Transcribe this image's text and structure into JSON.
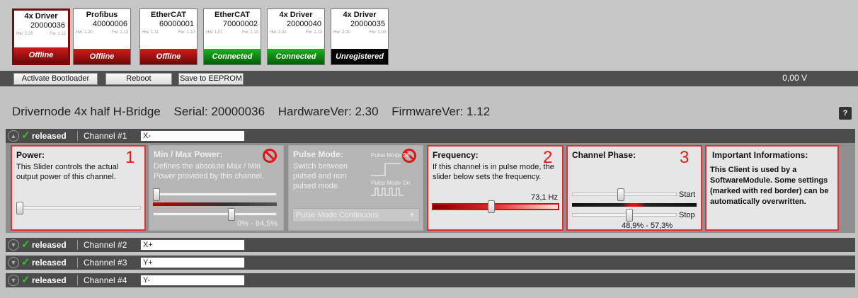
{
  "devices": [
    {
      "name": "4x Driver",
      "serial": "20000036",
      "hw": "Hw: 2.30",
      "fw": "Fw: 1.12",
      "status": "Offline"
    },
    {
      "name": "Profibus",
      "serial": "40000006",
      "hw": "Hw: 1.20",
      "fw": "Fw: 1.13",
      "status": "Offline"
    },
    {
      "name": "EtherCAT",
      "serial": "60000001",
      "hw": "Hw: 1.11",
      "fw": "Fw: 1.10",
      "status": "Offline"
    },
    {
      "name": "EtherCAT",
      "serial": "70000002",
      "hw": "Hw: 1.01",
      "fw": "Fw: 1.10",
      "status": "Connected"
    },
    {
      "name": "4x Driver",
      "serial": "20000040",
      "hw": "Hw: 2.30",
      "fw": "Fw: 1.13",
      "status": "Connected"
    },
    {
      "name": "4x Driver",
      "serial": "20000035",
      "hw": "Hw: 2.30",
      "fw": "Fw: 1.00",
      "status": "Unregistered"
    }
  ],
  "toolbar": {
    "bootloader_label": "Activate Bootloader",
    "reboot_label": "Reboot",
    "eeprom_label": "Save to EEPROM",
    "voltage": "0,00 V"
  },
  "header": {
    "title": "Drivernode 4x half H-Bridge",
    "serial": "Serial: 20000036",
    "hardware": "HardwareVer: 2.30",
    "firmware": "FirmwareVer: 1.12",
    "help_label": "?"
  },
  "channels": [
    {
      "status": "released",
      "name": "Channel #1",
      "value": "X-"
    },
    {
      "status": "released",
      "name": "Channel #2",
      "value": "X+"
    },
    {
      "status": "released",
      "name": "Channel #3",
      "value": "Y+"
    },
    {
      "status": "released",
      "name": "Channel #4",
      "value": "Y-"
    }
  ],
  "panels": {
    "power": {
      "title": "Power:",
      "text": "This Slider controls the actual output power of this channel.",
      "number": "1",
      "level": 0.0
    },
    "minmax": {
      "title": "Min / Max Power:",
      "text": "Defines the absolute Max / Min Power provided by this channel.",
      "range": "0% - 64,5%",
      "min": 0.0,
      "max": 0.645
    },
    "pulse": {
      "title": "Pulse Mode:",
      "text": "Switch between pulsed and non pulsed mode.",
      "mode_off": "Pulse Mode Off",
      "mode_on": "Pulse Mode On",
      "select": "Pulse Mode Continuous"
    },
    "frequency": {
      "title": "Frequency:",
      "text": "If this channel is in pulse mode, the slider below sets the frequency.",
      "value": "73,1 Hz",
      "number": "2"
    },
    "phase": {
      "title": "Channel Phase:",
      "start_label": "Start",
      "stop_label": "Stop",
      "range": "48,9% - 57,3%",
      "number": "3"
    },
    "info": {
      "title": "Important Informations:",
      "text": "This Client is used by a SoftwareModule. Some settings (marked with red border) can be automatically overwritten."
    }
  },
  "colors": {
    "offline": "#b81414",
    "connected": "#0f8f14",
    "unregistered": "#050505",
    "accent_red": "#e23030"
  }
}
